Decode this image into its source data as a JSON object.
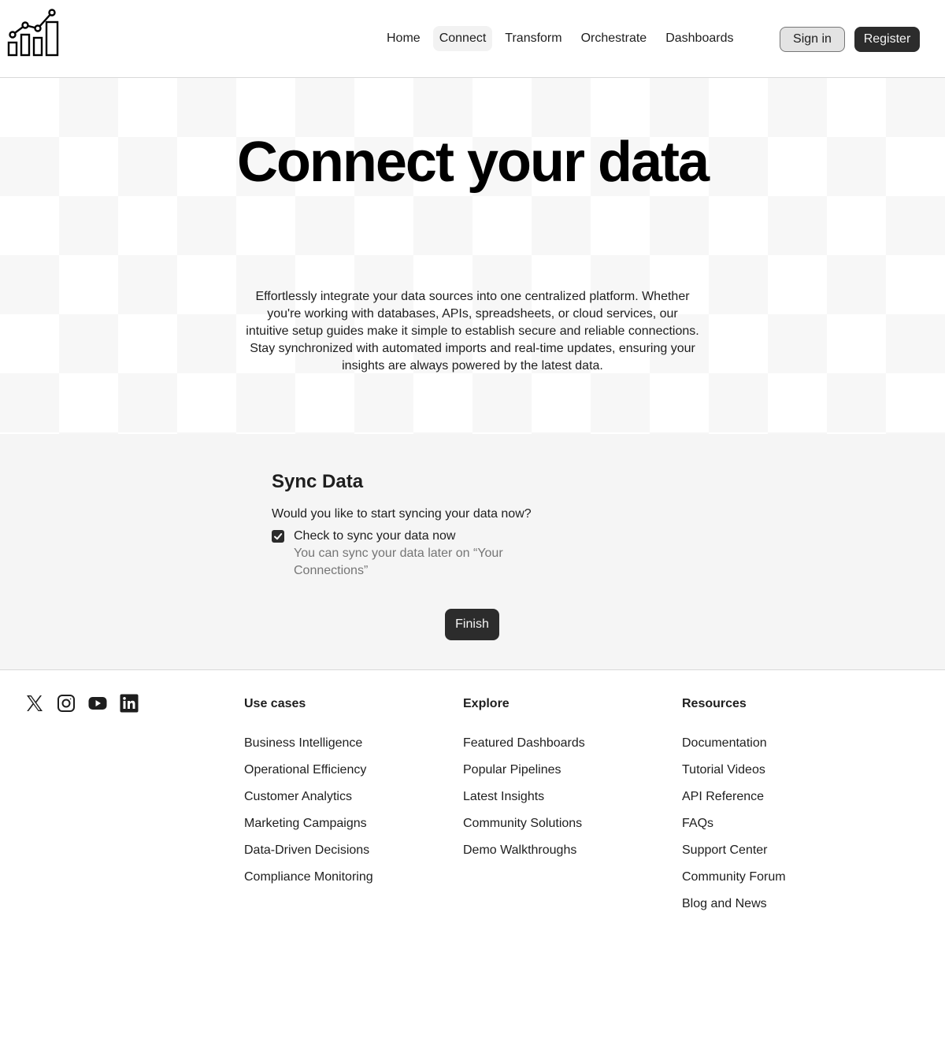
{
  "header": {
    "nav": [
      "Home",
      "Connect",
      "Transform",
      "Orchestrate",
      "Dashboards"
    ],
    "active_nav": "Connect",
    "signin_label": "Sign in",
    "register_label": "Register"
  },
  "hero": {
    "title": "Connect your data",
    "body": "Effortlessly integrate your data sources into one centralized platform. Whether you're working with databases, APIs, spreadsheets, or cloud services, our intuitive setup guides make it simple to establish secure and reliable connections. Stay synchronized with automated imports and real-time updates, ensuring your insights are always powered by the latest data."
  },
  "sync": {
    "title": "Sync Data",
    "question": "Would you like to start syncing your data now?",
    "checkbox_checked": true,
    "checkbox_label": "Check to sync your data now",
    "checkbox_description": "You can sync your data later on “Your Connections”",
    "finish_label": "Finish"
  },
  "footer": {
    "social_icons": [
      "x-icon",
      "instagram-icon",
      "youtube-icon",
      "linkedin-icon"
    ],
    "columns": [
      {
        "title": "Use cases",
        "items": [
          "Business Intelligence",
          "Operational Efficiency",
          "Customer Analytics",
          "Marketing Campaigns",
          "Data-Driven Decisions",
          "Compliance Monitoring"
        ]
      },
      {
        "title": "Explore",
        "items": [
          "Featured Dashboards",
          "Popular Pipelines",
          "Latest Insights",
          "Community Solutions",
          "Demo Walkthroughs"
        ]
      },
      {
        "title": "Resources",
        "items": [
          "Documentation",
          "Tutorial Videos",
          "API Reference",
          "FAQs",
          "Support Center",
          "Community Forum",
          "Blog and News"
        ]
      }
    ]
  },
  "colors": {
    "primary": "#2c2c2c",
    "text": "#1e1e1e",
    "muted": "#757575",
    "section_bg": "#f5f5f5"
  }
}
